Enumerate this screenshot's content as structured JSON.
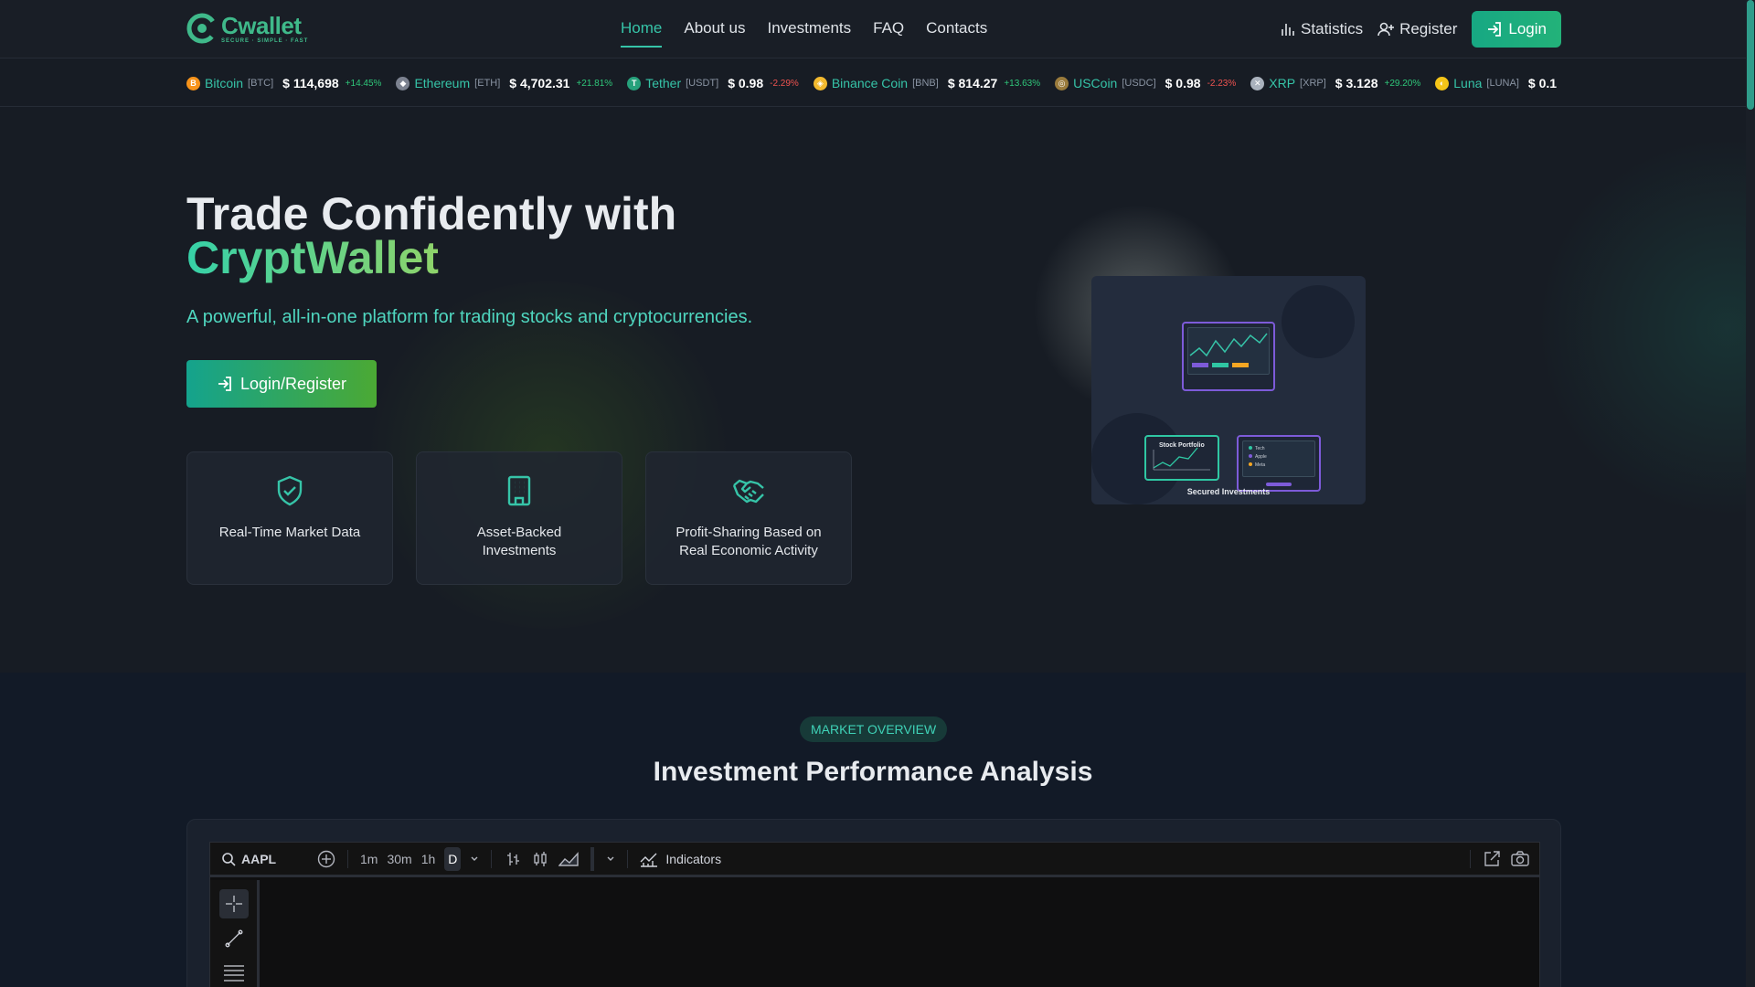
{
  "brand": {
    "name": "Cwallet",
    "tagline": "SECURE · SIMPLE · FAST",
    "accent": "#36c4a8"
  },
  "nav": {
    "links": [
      "Home",
      "About us",
      "Investments",
      "FAQ",
      "Contacts"
    ],
    "active": "Home",
    "statistics": "Statistics",
    "register": "Register",
    "login": "Login"
  },
  "ticker": [
    {
      "name": "Bitcoin",
      "symbol": "[BTC]",
      "price": "$ 114,698",
      "change": "+14.45%",
      "dir": "up",
      "icon": "bitcoin-icon",
      "color": "#f7931a"
    },
    {
      "name": "Ethereum",
      "symbol": "[ETH]",
      "price": "$ 4,702.31",
      "change": "+21.81%",
      "dir": "up",
      "icon": "ethereum-icon",
      "color": "#7c8290"
    },
    {
      "name": "Tether",
      "symbol": "[USDT]",
      "price": "$ 0.98",
      "change": "-2.29%",
      "dir": "down",
      "icon": "tether-icon",
      "color": "#26a17b"
    },
    {
      "name": "Binance Coin",
      "symbol": "[BNB]",
      "price": "$ 814.27",
      "change": "+13.63%",
      "dir": "up",
      "icon": "binance-icon",
      "color": "#f3ba2f"
    },
    {
      "name": "USCoin",
      "symbol": "[USDC]",
      "price": "$ 0.98",
      "change": "-2.23%",
      "dir": "down",
      "icon": "usdc-icon",
      "color": "#9a7b3c"
    },
    {
      "name": "XRP",
      "symbol": "[XRP]",
      "price": "$ 3.128",
      "change": "+29.20%",
      "dir": "up",
      "icon": "xrp-icon",
      "color": "#aab2bd"
    },
    {
      "name": "Luna",
      "symbol": "[LUNA]",
      "price": "$ 0.1",
      "change": "",
      "dir": "up",
      "icon": "luna-icon",
      "color": "#f5c518"
    }
  ],
  "hero": {
    "title_line1": "Trade Confidently with",
    "title_line2": "CryptWallet",
    "subtitle": "A powerful, all-in-one platform for trading stocks and cryptocurrencies.",
    "cta": "Login/Register",
    "features": [
      {
        "label": "Real-Time Market Data",
        "icon": "shield-check-icon"
      },
      {
        "label": "Asset-Backed Investments",
        "icon": "building-icon"
      },
      {
        "label": "Profit-Sharing Based on Real Economic Activity",
        "icon": "handshake-icon"
      }
    ],
    "illustration": {
      "caption": "Secured Investments",
      "panel_label": "Stock Portfolio",
      "legend": [
        "Tech",
        "Apple",
        "Meta"
      ]
    }
  },
  "market": {
    "pill": "MARKET OVERVIEW",
    "title": "Investment Performance Analysis",
    "toolbar": {
      "symbol": "AAPL",
      "intervals": [
        "1m",
        "30m",
        "1h",
        "D"
      ],
      "selected_interval": "D",
      "indicators": "Indicators"
    }
  }
}
